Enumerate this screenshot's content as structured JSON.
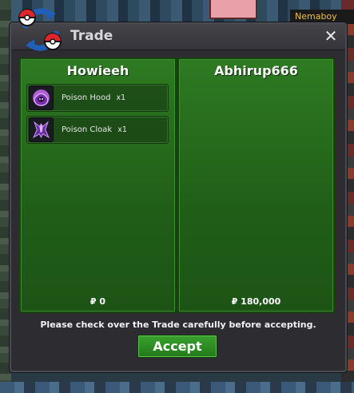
{
  "background": {
    "nameplate_text": "Nemaboy"
  },
  "window": {
    "title": "Trade",
    "close_label": "✕"
  },
  "left_trader": {
    "name": "Howieeh",
    "items": [
      {
        "name": "Poison Hood",
        "qty": "x1",
        "icon": "poison-hood-icon"
      },
      {
        "name": "Poison Cloak",
        "qty": "x1",
        "icon": "poison-cloak-icon"
      }
    ],
    "money": "₽ 0"
  },
  "right_trader": {
    "name": "Abhirup666",
    "items": [],
    "money": "₽ 180,000"
  },
  "notice": "Please check over the Trade carefully before accepting.",
  "accept_label": "Accept",
  "colors": {
    "panel_green": "#2e7a22",
    "window_bg": "#2c2c31",
    "accept_green": "#3aa02e"
  }
}
